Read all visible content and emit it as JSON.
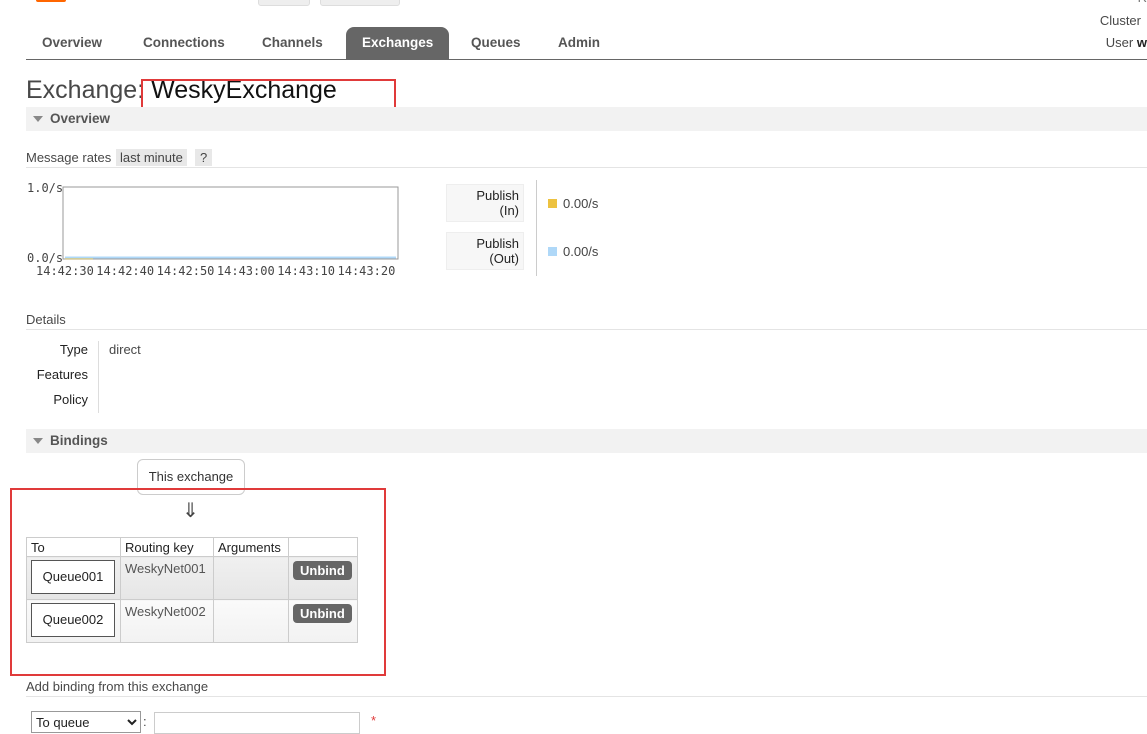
{
  "header": {
    "cluster_label": "Cluster",
    "user_label": "User",
    "user_name_fragment": "w",
    "top_right_fragment": "R"
  },
  "tabs": [
    {
      "label": "Overview",
      "active": false
    },
    {
      "label": "Connections",
      "active": false
    },
    {
      "label": "Channels",
      "active": false
    },
    {
      "label": "Exchanges",
      "active": true
    },
    {
      "label": "Queues",
      "active": false
    },
    {
      "label": "Admin",
      "active": false
    }
  ],
  "page": {
    "title_prefix": "Exchange:",
    "exchange_name": "WeskyExchange"
  },
  "overview": {
    "section_title": "Overview",
    "message_rates_label": "Message rates",
    "rate_range": "last minute",
    "help": "?"
  },
  "chart_data": {
    "type": "line",
    "ylim": [
      0.0,
      1.0
    ],
    "ytick_labels": [
      "1.0/s",
      "0.0/s"
    ],
    "x": [
      "14:42:30",
      "14:42:40",
      "14:42:50",
      "14:43:00",
      "14:43:10",
      "14:43:20"
    ],
    "series": [
      {
        "name": "Publish (In)",
        "color": "#edc240",
        "values": [
          0,
          0,
          0,
          0,
          0,
          0
        ]
      },
      {
        "name": "Publish (Out)",
        "color": "#afd8f8",
        "values": [
          0,
          0,
          0,
          0,
          0,
          0
        ]
      }
    ]
  },
  "legend": [
    {
      "line1": "Publish",
      "line2": "(In)",
      "value": "0.00/s",
      "color": "#edc240"
    },
    {
      "line1": "Publish",
      "line2": "(Out)",
      "value": "0.00/s",
      "color": "#afd8f8"
    }
  ],
  "details": {
    "section_label": "Details",
    "type_label": "Type",
    "type_value": "direct",
    "features_label": "Features",
    "policy_label": "Policy"
  },
  "bindings": {
    "section_title": "Bindings",
    "source_label": "This exchange",
    "arrow": "⇓",
    "columns": [
      "To",
      "Routing key",
      "Arguments"
    ],
    "rows": [
      {
        "to": "Queue001",
        "routing_key": "WeskyNet001",
        "arguments": "",
        "action": "Unbind"
      },
      {
        "to": "Queue002",
        "routing_key": "WeskyNet002",
        "arguments": "",
        "action": "Unbind"
      }
    ]
  },
  "add_binding": {
    "label": "Add binding from this exchange",
    "destination_type": "To queue",
    "colon": ":",
    "required_mark": "*"
  }
}
